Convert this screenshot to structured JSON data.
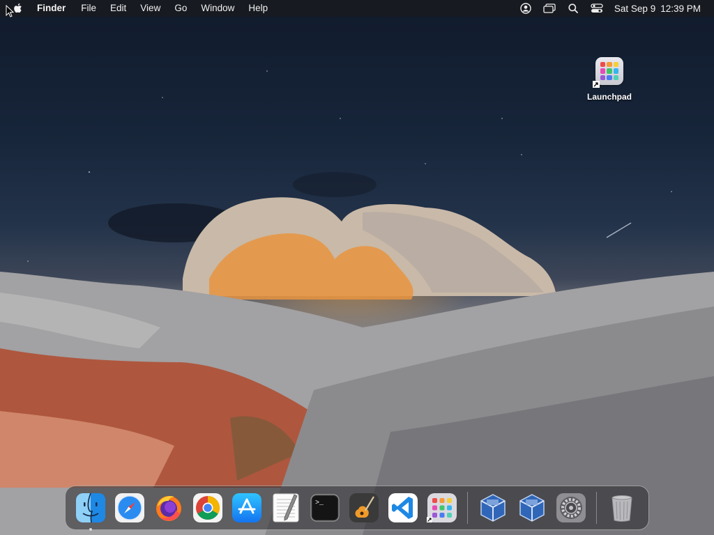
{
  "menubar": {
    "app_name": "Finder",
    "menus": [
      "File",
      "Edit",
      "View",
      "Go",
      "Window",
      "Help"
    ],
    "status_icons": [
      "user-account-icon",
      "screen-mirroring-icon",
      "spotlight-search-icon",
      "control-center-icon"
    ],
    "clock": {
      "date": "Sat Sep 9",
      "time": "12:39 PM"
    }
  },
  "desktop": {
    "icons": [
      {
        "label": "Launchpad",
        "icon": "launchpad-icon",
        "alias": true
      }
    ]
  },
  "dock": {
    "apps": [
      {
        "icon": "finder-icon",
        "running": true
      },
      {
        "icon": "safari-icon",
        "running": false
      },
      {
        "icon": "firefox-icon",
        "running": false
      },
      {
        "icon": "chrome-icon",
        "running": false
      },
      {
        "icon": "app-store-icon",
        "running": false
      },
      {
        "icon": "textedit-icon",
        "running": false
      },
      {
        "icon": "terminal-icon",
        "running": false
      },
      {
        "icon": "garageband-icon",
        "running": false
      },
      {
        "icon": "vscode-icon",
        "running": false
      },
      {
        "icon": "launchpad-icon",
        "running": false
      }
    ],
    "others": [
      {
        "icon": "virtualbox-icon"
      },
      {
        "icon": "virtualbox-icon"
      },
      {
        "icon": "system-settings-icon"
      }
    ],
    "trash": {
      "icon": "trash-icon"
    },
    "terminal_prompt": ">_"
  },
  "colors": {
    "menubar_bg": "#181a20",
    "accent_blue": "#1e88e5"
  }
}
